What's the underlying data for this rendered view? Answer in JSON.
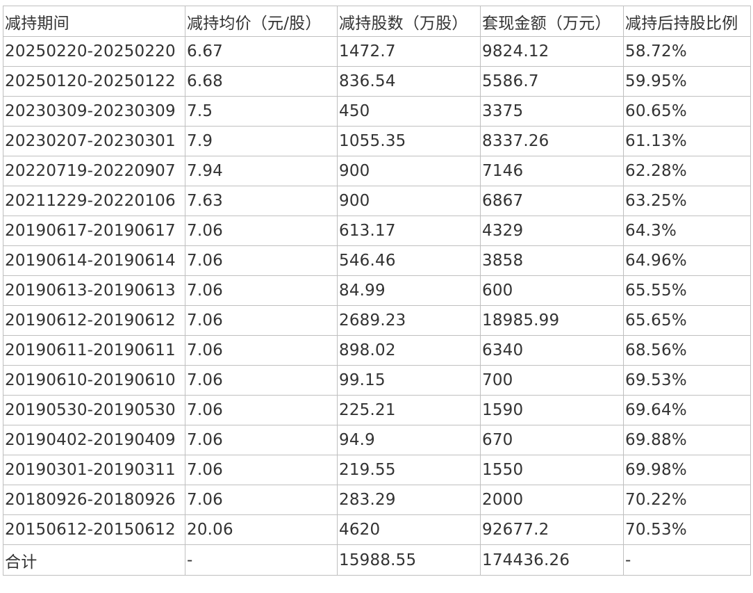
{
  "table": {
    "headers": [
      "减持期间",
      "减持均价（元/股）",
      "减持股数（万股）",
      "套现金额（万元）",
      "减持后持股比例"
    ],
    "rows": [
      [
        "20250220-20250220",
        "6.67",
        "1472.7",
        "9824.12",
        "58.72%"
      ],
      [
        "20250120-20250122",
        "6.68",
        "836.54",
        "5586.7",
        "59.95%"
      ],
      [
        "20230309-20230309",
        "7.5",
        "450",
        "3375",
        "60.65%"
      ],
      [
        "20230207-20230301",
        "7.9",
        "1055.35",
        "8337.26",
        "61.13%"
      ],
      [
        "20220719-20220907",
        "7.94",
        "900",
        "7146",
        "62.28%"
      ],
      [
        "20211229-20220106",
        "7.63",
        "900",
        "6867",
        "63.25%"
      ],
      [
        "20190617-20190617",
        "7.06",
        "613.17",
        "4329",
        "64.3%"
      ],
      [
        "20190614-20190614",
        "7.06",
        "546.46",
        "3858",
        "64.96%"
      ],
      [
        "20190613-20190613",
        "7.06",
        "84.99",
        "600",
        "65.55%"
      ],
      [
        "20190612-20190612",
        "7.06",
        "2689.23",
        "18985.99",
        "65.65%"
      ],
      [
        "20190611-20190611",
        "7.06",
        "898.02",
        "6340",
        "68.56%"
      ],
      [
        "20190610-20190610",
        "7.06",
        "99.15",
        "700",
        "69.53%"
      ],
      [
        "20190530-20190530",
        "7.06",
        "225.21",
        "1590",
        "69.64%"
      ],
      [
        "20190402-20190409",
        "7.06",
        "94.9",
        "670",
        "69.88%"
      ],
      [
        "20190301-20190311",
        "7.06",
        "219.55",
        "1550",
        "69.98%"
      ],
      [
        "20180926-20180926",
        "7.06",
        "283.29",
        "2000",
        "70.22%"
      ],
      [
        "20150612-20150612",
        "20.06",
        "4620",
        "92677.2",
        "70.53%"
      ]
    ],
    "total": [
      "合计",
      "-",
      "15988.55",
      "174436.26",
      "-"
    ]
  }
}
